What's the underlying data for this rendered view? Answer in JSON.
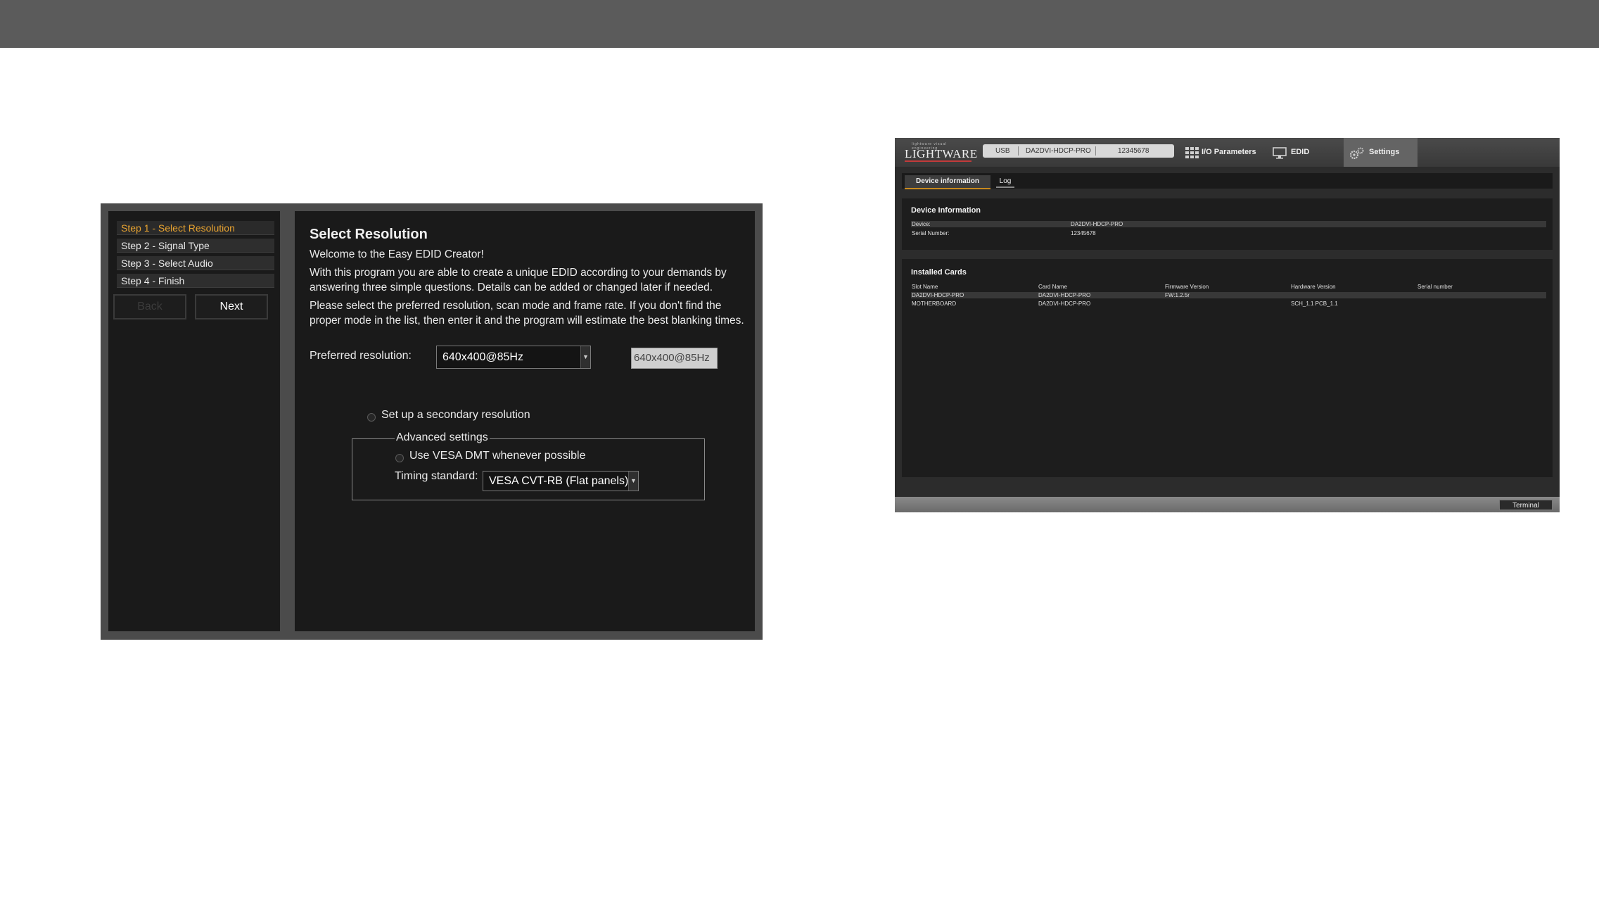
{
  "wizard": {
    "steps": [
      {
        "label": "Step 1 - Select Resolution"
      },
      {
        "label": "Step 2 - Signal Type"
      },
      {
        "label": "Step 3 - Select Audio"
      },
      {
        "label": "Step 4 - Finish"
      }
    ],
    "back_label": "Back",
    "next_label": "Next",
    "title": "Select Resolution",
    "welcome": "Welcome to the Easy EDID Creator!",
    "intro": "With this program you are able to create a unique EDID according to your demands by answering three simple questions. Details can be added or changed later if needed.",
    "instructions": "Please select the preferred resolution, scan mode and frame rate. If you don't find the proper mode in the list, then enter it and the program will estimate the best blanking times.",
    "preferred_label": "Preferred resolution:",
    "preferred_value": "640x400@85Hz",
    "preferred_text": "640x400@85Hz",
    "secondary_label": "Set up a secondary resolution",
    "advanced_legend": "Advanced settings",
    "vesa_label": "Use VESA DMT whenever possible",
    "timing_label": "Timing standard:",
    "timing_value": "VESA CVT-RB (Flat panels)",
    "active_step_color": "#e8a330"
  },
  "ldc": {
    "logo_small": "lightware visual engineering",
    "logo": "LIGHTWARE",
    "connection": {
      "type": "USB",
      "device": "DA2DVI-HDCP-PRO",
      "serial": "12345678"
    },
    "nav": [
      "I/O Parameters",
      "EDID",
      "Settings"
    ],
    "tabs": [
      "Device information",
      "Log"
    ],
    "device_info": {
      "title": "Device Information",
      "rows": [
        {
          "label": "Device:",
          "value": "DA2DVI-HDCP-PRO"
        },
        {
          "label": "Serial Number:",
          "value": "12345678"
        }
      ]
    },
    "installed_cards": {
      "title": "Installed Cards",
      "headers": [
        "Slot Name",
        "Card Name",
        "Firmware Version",
        "Hardware Version",
        "Serial number"
      ],
      "rows": [
        [
          "DA2DVI-HDCP-PRO",
          "DA2DVI-HDCP-PRO",
          "FW:1.2.5r",
          "",
          ""
        ],
        [
          "MOTHERBOARD",
          "DA2DVI-HDCP-PRO",
          "",
          "SCH_1.1 PCB_1.1",
          ""
        ]
      ]
    },
    "terminal_label": "Terminal"
  }
}
